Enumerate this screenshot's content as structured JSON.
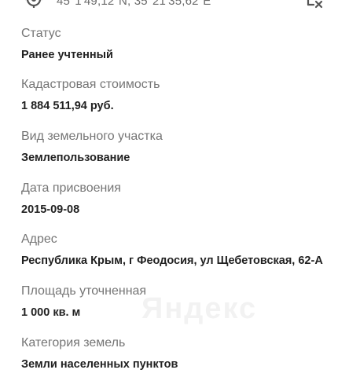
{
  "header": {
    "coordinates": "45°1'49,12\"N, 35°21'35,62\"E",
    "location_icon": "location-pin-icon",
    "clear_icon": "clear-location-icon"
  },
  "fields": [
    {
      "label": "Статус",
      "value": "Ранее учтенный"
    },
    {
      "label": "Кадастровая стоимость",
      "value": "1 884 511,94 руб."
    },
    {
      "label": "Вид земельного участка",
      "value": "Землепользование"
    },
    {
      "label": "Дата присвоения",
      "value": "2015-09-08"
    },
    {
      "label": "Адрес",
      "value": "Республика Крым, г Феодосия, ул Щебетовская, 62-А"
    },
    {
      "label": "Площадь уточненная",
      "value": "1 000 кв. м"
    },
    {
      "label": "Категория земель",
      "value": "Земли населенных пунктов"
    }
  ],
  "colors": {
    "label": "#757575",
    "value": "#212121",
    "icon": "#555555"
  }
}
